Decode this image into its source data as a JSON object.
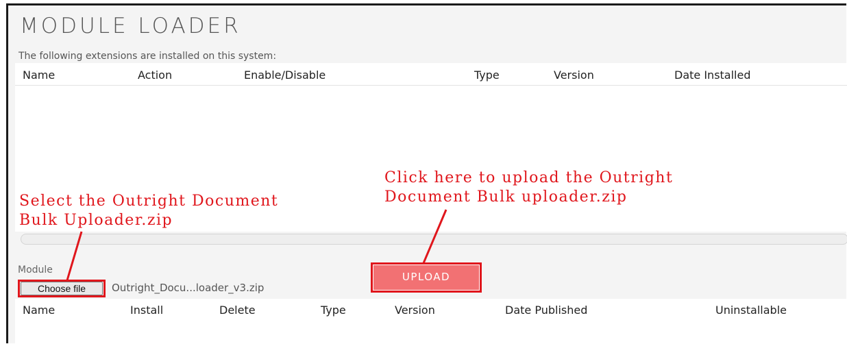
{
  "page": {
    "title": "MODULE LOADER",
    "subtitle": "The following extensions are installed on this system:"
  },
  "installed_table": {
    "columns": [
      "Name",
      "Action",
      "Enable/Disable",
      "Type",
      "Version",
      "Date Installed"
    ],
    "rows": []
  },
  "upload_form": {
    "module_label": "Module",
    "choose_file_label": "Choose file",
    "selected_file": "Outright_Docu...loader_v3.zip",
    "upload_label": "UPLOAD"
  },
  "available_table": {
    "columns": [
      "Name",
      "Install",
      "Delete",
      "Type",
      "Version",
      "Date Published",
      "Uninstallable"
    ],
    "rows": []
  },
  "annotations": {
    "select_note": [
      "Select the Outright Document",
      "Bulk Uploader.zip"
    ],
    "upload_note": [
      "Click here to upload the Outright",
      "Document Bulk uploader.zip"
    ],
    "color": "#e0161c"
  },
  "colors": {
    "background": "#f4f4f4",
    "upload_button": "#f27173",
    "highlight": "#e0161c"
  }
}
